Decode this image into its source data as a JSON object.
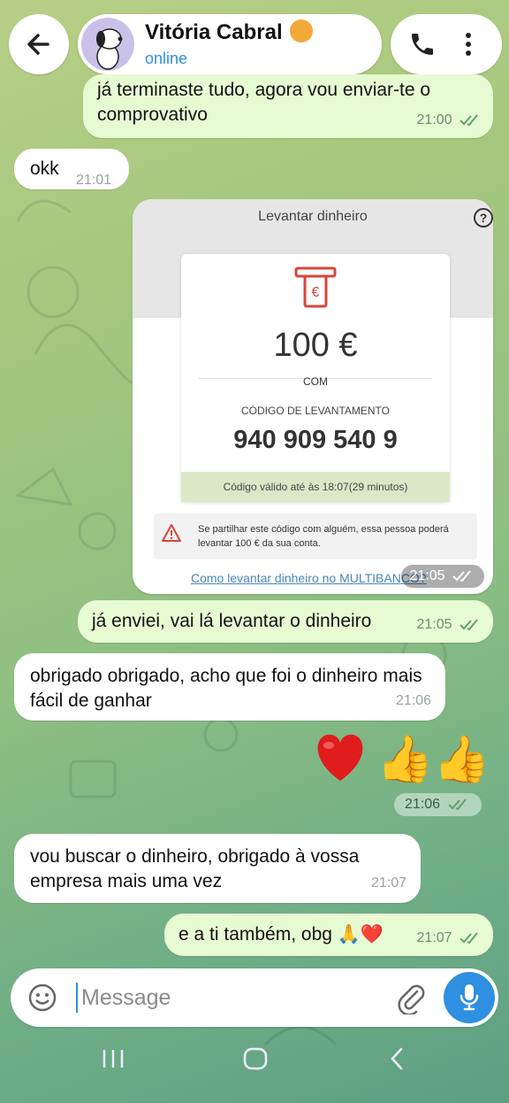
{
  "header": {
    "contact_name": "Vitória Cabral",
    "status": "online"
  },
  "messages": [
    {
      "dir": "out",
      "text": "já terminaste tudo, agora vou enviar-te o comprovativo",
      "time": "21:00",
      "read": true
    },
    {
      "dir": "in",
      "text": "okk",
      "time": "21:01"
    },
    {
      "dir": "out",
      "type": "image",
      "time": "21:05",
      "read": true
    },
    {
      "dir": "out",
      "text": "já enviei, vai lá levantar o dinheiro",
      "time": "21:05",
      "read": true
    },
    {
      "dir": "in",
      "text": "obrigado obrigado, acho que foi o dinheiro mais fácil de ganhar",
      "time": "21:06"
    },
    {
      "dir": "out",
      "type": "emoji",
      "text": "❤️👍👍",
      "time": "21:06",
      "read": true
    },
    {
      "dir": "in",
      "text": "vou buscar o dinheiro, obrigado à vossa empresa mais uma vez",
      "time": "21:07"
    },
    {
      "dir": "out",
      "text": "e a ti também, obg 🙏❤️",
      "time": "21:07",
      "read": true
    }
  ],
  "receipt": {
    "title": "Levantar dinheiro",
    "help_icon": "question-icon",
    "amount": "100 €",
    "com_label": "COM",
    "code_label": "CÓDIGO DE LEVANTAMENTO",
    "code": "940 909 540 9",
    "validity": "Código válido até às 18:07(29 minutos)",
    "warning": "Se partilhar este código com alguém, essa pessoa poderá levantar 100 € da sua conta.",
    "link": "Como levantar dinheiro no MULTIBANCO?"
  },
  "composer": {
    "placeholder": "Message"
  },
  "colors": {
    "outgoing_bubble": "#e7fbd3",
    "accent_blue": "#2f8fe0",
    "check_green": "#5fa06d"
  }
}
